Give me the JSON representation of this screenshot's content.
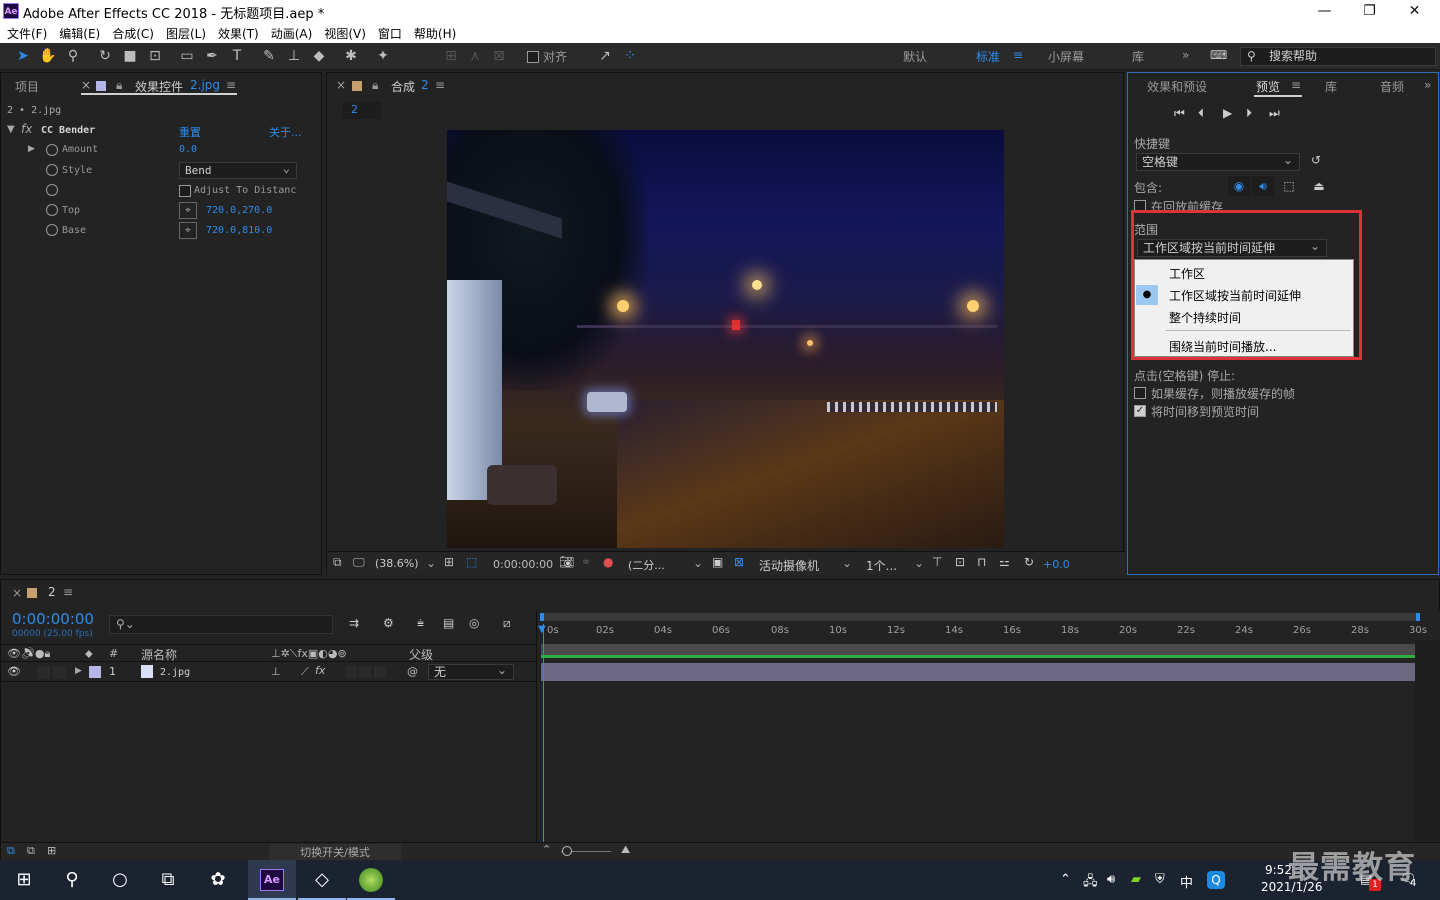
{
  "title": {
    "app": "Adobe After Effects CC 2018 - 无标题项目.aep *"
  },
  "menu": [
    "文件(F)",
    "编辑(E)",
    "合成(C)",
    "图层(L)",
    "效果(T)",
    "动画(A)",
    "视图(V)",
    "窗口",
    "帮助(H)"
  ],
  "toolbar": {
    "align_label": "对齐",
    "workspaces": [
      "默认",
      "标准",
      "小屏幕",
      "库"
    ],
    "help_placeholder": "搜索帮助"
  },
  "left_panel": {
    "tab_project": "项目",
    "tab_effects": "效果控件",
    "tab_effects_file": "2.jpg",
    "breadcrumb": "2 • 2.jpg",
    "effect_name": "CC Bender",
    "reset": "重置",
    "about": "关于...",
    "props": [
      {
        "label": "Amount",
        "value": "0.0"
      },
      {
        "label": "Style",
        "value": "Bend"
      },
      {
        "label": "",
        "value": "Adjust To Distanc"
      },
      {
        "label": "Top",
        "value": "720.0,270.0"
      },
      {
        "label": "Base",
        "value": "720.0,810.0"
      }
    ]
  },
  "comp": {
    "tab_label": "合成",
    "tab_name": "2",
    "subtab": "2",
    "footer": {
      "zoom": "(38.6%)",
      "time": "0:00:00:00",
      "resolution": "(二分...",
      "camera": "活动摄像机",
      "views": "1个...",
      "offset": "+0.0"
    }
  },
  "right_panel": {
    "tabs": [
      "效果和预设",
      "预览",
      "库",
      "音频"
    ],
    "shortcut_label": "快捷键",
    "shortcut_value": "空格键",
    "include_label": "包含:",
    "cache_before": "在回放前缓存",
    "range_label": "范围",
    "range_value": "工作区域按当前时间延伸",
    "options": [
      "工作区",
      "工作区域按当前时间延伸",
      "整个持续时间",
      "围绕当前时间播放..."
    ],
    "click_stop": "点击(空格键) 停止:",
    "if_cached": "如果缓存，则播放缓存的帧",
    "move_time": "将时间移到预览时间"
  },
  "timeline": {
    "tab": "2",
    "timecode": "0:00:00:00",
    "frames": "00000 (25.00 fps)",
    "col_source": "源名称",
    "col_parent": "父级",
    "layer_num": "1",
    "layer_name": "2.jpg",
    "parent_value": "无",
    "ticks": [
      "0s",
      "02s",
      "04s",
      "06s",
      "08s",
      "10s",
      "12s",
      "14s",
      "16s",
      "18s",
      "20s",
      "22s",
      "24s",
      "26s",
      "28s",
      "30s"
    ],
    "bottom_label": "切换开关/模式"
  },
  "taskbar": {
    "time": "9:52",
    "date": "2021/1/26",
    "ime": "中",
    "notif": "4",
    "badge": "1"
  },
  "watermark": "最需教育"
}
